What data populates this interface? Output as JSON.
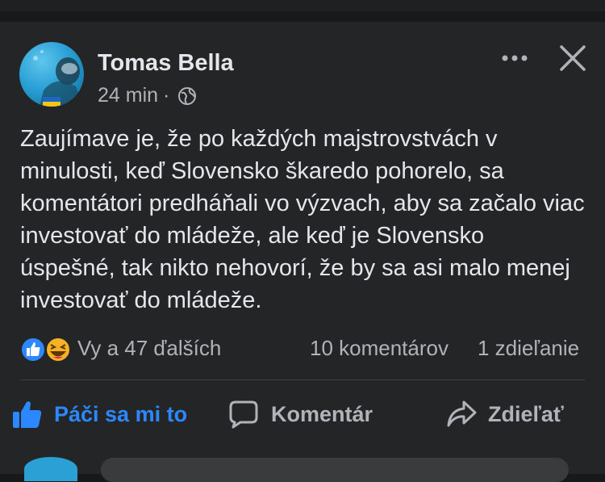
{
  "post": {
    "author": "Tomas Bella",
    "time": "24 min",
    "separator": "·",
    "privacy_icon": "globe-icon",
    "text": "Zaujímave je, že po každých majstrovstvách v minulosti, keď Slovensko škaredo pohorelo, sa komentátori predháňali vo výzvach, aby sa začalo viac investovať do mládeže, ale keď je Slovensko úspešné, tak nikto nehovorí, že by sa asi malo menej investovať do mládeže."
  },
  "reactions": {
    "icons": [
      "like-reaction-icon",
      "haha-reaction-icon"
    ],
    "summary": "Vy a 47 ďalších",
    "comments": "10 komentárov",
    "shares": "1 zdieľanie"
  },
  "actions": {
    "like": "Páči sa mi to",
    "comment": "Komentár",
    "share": "Zdieľať"
  },
  "colors": {
    "background": "#18191a",
    "card": "#242526",
    "text_primary": "#e4e6eb",
    "text_secondary": "#b0b3b8",
    "accent": "#2d88ff"
  }
}
